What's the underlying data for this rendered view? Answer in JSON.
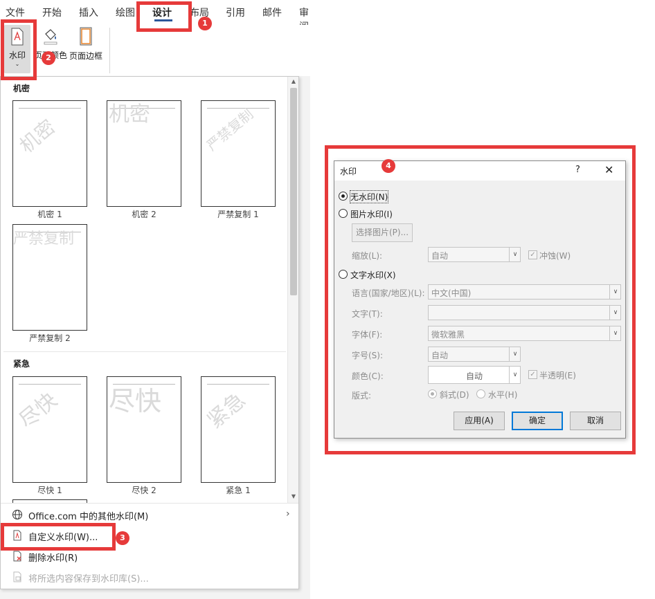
{
  "tabs": [
    "文件",
    "开始",
    "插入",
    "绘图",
    "设计",
    "布局",
    "引用",
    "邮件",
    "审阅"
  ],
  "ribbon": {
    "watermark_label": "水印",
    "page_color_label": "页面颜色",
    "page_border_label": "页面边框"
  },
  "gallery": {
    "section1_title": "机密",
    "section2_title": "紧急",
    "items1": [
      {
        "caption": "机密 1",
        "text": "机密"
      },
      {
        "caption": "机密 2",
        "text": "机密"
      },
      {
        "caption": "严禁复制 1",
        "text": "严禁复制"
      },
      {
        "caption": "严禁复制 2",
        "text": "严禁复制"
      }
    ],
    "items2": [
      {
        "caption": "尽快 1",
        "text": "尽快"
      },
      {
        "caption": "尽快 2",
        "text": "尽快"
      },
      {
        "caption": "紧急 1",
        "text": "紧急"
      }
    ]
  },
  "menu": {
    "more_watermarks": "Office.com 中的其他水印(M)",
    "custom_watermark": "自定义水印(W)...",
    "remove_watermark": "删除水印(R)",
    "save_to_gallery": "将所选内容保存到水印库(S)..."
  },
  "badges": [
    "1",
    "2",
    "3",
    "4"
  ],
  "dialog": {
    "title": "水印",
    "help": "?",
    "close": "✕",
    "no_watermark": "无水印(N)",
    "picture_watermark": "图片水印(I)",
    "select_picture": "选择图片(P)...",
    "scale_label": "缩放(L):",
    "scale_value": "自动",
    "washout_label": "冲蚀(W)",
    "text_watermark": "文字水印(X)",
    "language_label": "语言(国家/地区)(L):",
    "language_value": "中文(中国)",
    "text_label": "文字(T):",
    "text_value": "",
    "font_label": "字体(F):",
    "font_value": "微软雅黑",
    "size_label": "字号(S):",
    "size_value": "自动",
    "color_label": "颜色(C):",
    "color_value": "自动",
    "semitransparent_label": "半透明(E)",
    "layout_label": "版式:",
    "diagonal_label": "斜式(D)",
    "horizontal_label": "水平(H)",
    "apply_button": "应用(A)",
    "ok_button": "确定",
    "cancel_button": "取消"
  },
  "colors": {
    "highlight": "#e63a3a",
    "accent": "#2b579a",
    "focus": "#0078d7"
  }
}
